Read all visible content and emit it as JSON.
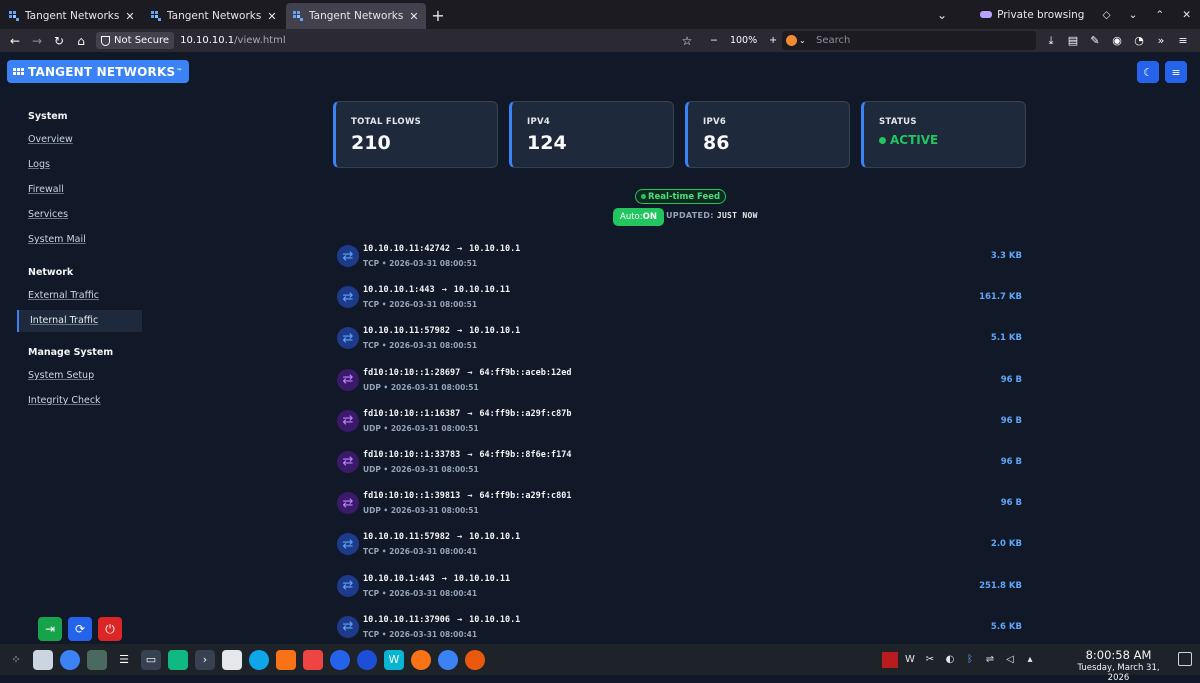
{
  "browser": {
    "tabs": [
      {
        "title": "Tangent Networks UTM —",
        "active": false
      },
      {
        "title": "Tangent Networks - Home",
        "active": false
      },
      {
        "title": "Tangent Networks | Web i",
        "active": true
      }
    ],
    "private_label": "Private browsing",
    "not_secure_label": "Not Secure",
    "url_host": "10.10.10.1",
    "url_path": "/view.html",
    "zoom": "100%",
    "search_placeholder": "Search"
  },
  "app": {
    "brand": "TANGENT NETWORKS",
    "brand_mark": "™"
  },
  "sidebar": {
    "sections": [
      {
        "title": "System",
        "items": [
          {
            "label": "Overview"
          },
          {
            "label": "Logs"
          },
          {
            "label": "Firewall"
          },
          {
            "label": "Services"
          },
          {
            "label": "System Mail"
          }
        ]
      },
      {
        "title": "Network",
        "items": [
          {
            "label": "External Traffic"
          },
          {
            "label": "Internal Traffic",
            "active": true
          }
        ]
      },
      {
        "title": "Manage System",
        "items": [
          {
            "label": "System Setup"
          },
          {
            "label": "Integrity Check"
          }
        ]
      }
    ]
  },
  "stats": {
    "total_flows_label": "TOTAL FLOWS",
    "total_flows_value": "210",
    "ipv4_label": "IPV4",
    "ipv4_value": "124",
    "ipv6_label": "IPV6",
    "ipv6_value": "86",
    "status_label": "STATUS",
    "status_value": "ACTIVE"
  },
  "feed": {
    "badge": "Real-time Feed",
    "auto_prefix": "Auto:",
    "auto_value": "ON",
    "updated_label": "UPDATED:",
    "updated_value": "JUST NOW"
  },
  "flows": [
    {
      "src": "10.10.10.11:42742",
      "dst": "10.10.10.1",
      "proto": "TCP",
      "time": "2026-03-31 08:00:51",
      "size": "3.3 KB"
    },
    {
      "src": "10.10.10.1:443",
      "dst": "10.10.10.11",
      "proto": "TCP",
      "time": "2026-03-31 08:00:51",
      "size": "161.7 KB"
    },
    {
      "src": "10.10.10.11:57982",
      "dst": "10.10.10.1",
      "proto": "TCP",
      "time": "2026-03-31 08:00:51",
      "size": "5.1 KB"
    },
    {
      "src": "fd10:10:10::1:28697",
      "dst": "64:ff9b::aceb:12ed",
      "proto": "UDP",
      "time": "2026-03-31 08:00:51",
      "size": "96 B"
    },
    {
      "src": "fd10:10:10::1:16387",
      "dst": "64:ff9b::a29f:c87b",
      "proto": "UDP",
      "time": "2026-03-31 08:00:51",
      "size": "96 B"
    },
    {
      "src": "fd10:10:10::1:33783",
      "dst": "64:ff9b::8f6e:f174",
      "proto": "UDP",
      "time": "2026-03-31 08:00:51",
      "size": "96 B"
    },
    {
      "src": "fd10:10:10::1:39813",
      "dst": "64:ff9b::a29f:c801",
      "proto": "UDP",
      "time": "2026-03-31 08:00:51",
      "size": "96 B"
    },
    {
      "src": "10.10.10.11:57982",
      "dst": "10.10.10.1",
      "proto": "TCP",
      "time": "2026-03-31 08:00:41",
      "size": "2.0 KB"
    },
    {
      "src": "10.10.10.1:443",
      "dst": "10.10.10.11",
      "proto": "TCP",
      "time": "2026-03-31 08:00:41",
      "size": "251.8 KB"
    },
    {
      "src": "10.10.10.11:37906",
      "dst": "10.10.10.1",
      "proto": "TCP",
      "time": "2026-03-31 08:00:41",
      "size": "5.6 KB"
    }
  ],
  "colors": {
    "accent": "#3b82f6",
    "success": "#22c55e",
    "danger": "#dc2626",
    "tcp": "#60a5fa",
    "udp": "#c084fc"
  },
  "clock": {
    "time": "8:00:58 AM",
    "date": "Tuesday, March 31, 2026"
  }
}
